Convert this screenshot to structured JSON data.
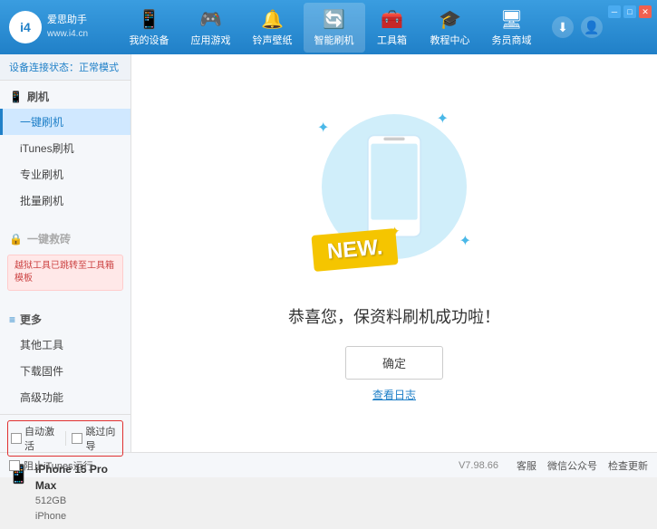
{
  "app": {
    "logo_short": "i4",
    "logo_name": "爱思助手",
    "logo_url": "www.i4.cn"
  },
  "nav": {
    "items": [
      {
        "id": "my-device",
        "icon": "📱",
        "label": "我的设备"
      },
      {
        "id": "apps-games",
        "icon": "👤",
        "label": "应用游戏"
      },
      {
        "id": "ringtones",
        "icon": "🔔",
        "label": "铃声壁纸"
      },
      {
        "id": "smart-flash",
        "icon": "🔄",
        "label": "智能刷机",
        "active": true
      },
      {
        "id": "toolbox",
        "icon": "🧰",
        "label": "工具箱"
      },
      {
        "id": "tutorial",
        "icon": "🎓",
        "label": "教程中心"
      },
      {
        "id": "store",
        "icon": "🖥",
        "label": "务员商域"
      }
    ]
  },
  "sidebar": {
    "status_label": "设备连接状态：",
    "status_value": "正常模式",
    "sections": [
      {
        "id": "flash",
        "icon": "📱",
        "title": "刷机",
        "items": [
          {
            "id": "one-key-flash",
            "label": "一键刷机",
            "active": true
          },
          {
            "id": "itunes-flash",
            "label": "iTunes刷机"
          },
          {
            "id": "pro-flash",
            "label": "专业刷机"
          },
          {
            "id": "batch-flash",
            "label": "批量刷机"
          }
        ]
      },
      {
        "id": "one-key-rescue",
        "icon": "🔒",
        "title": "一键救砖",
        "disabled": true,
        "notice": "越狱工具已跳转至工具箱模板"
      },
      {
        "id": "more",
        "icon": "≡",
        "title": "更多",
        "items": [
          {
            "id": "other-tools",
            "label": "其他工具"
          },
          {
            "id": "download-firmware",
            "label": "下载固件"
          },
          {
            "id": "advanced",
            "label": "高级功能"
          }
        ]
      }
    ],
    "auto_activate_label": "自动激活",
    "skip_activate_label": "跳过向导",
    "device_name": "iPhone 15 Pro Max",
    "device_storage": "512GB",
    "device_type": "iPhone"
  },
  "main": {
    "new_badge": "NEW.",
    "success_text": "恭喜您，保资料刷机成功啦！",
    "confirm_btn": "确定",
    "log_link": "查看日志"
  },
  "bottombar": {
    "stop_itunes_label": "阻止iTunes运行",
    "version": "V7.98.66",
    "links": [
      "客服",
      "微信公众号",
      "检查更新"
    ]
  },
  "window_controls": {
    "minimize": "─",
    "maximize": "□",
    "close": "✕"
  }
}
